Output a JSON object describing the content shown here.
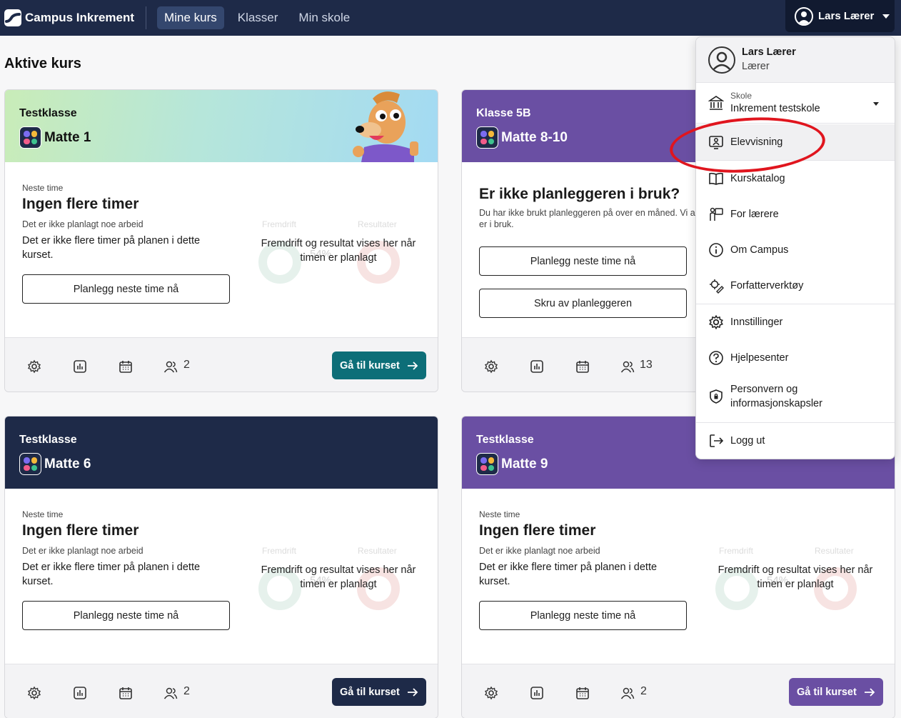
{
  "topbar": {
    "brand": "Campus Inkrement",
    "nav": [
      "Mine kurs",
      "Klasser",
      "Min skole"
    ],
    "active_nav": "Mine kurs",
    "user_name": "Lars Lærer",
    "bg_color": "#1e2a48"
  },
  "page_title": "Aktive kurs",
  "cards": [
    {
      "class_name": "Testklasse",
      "course_name": "Matte 1",
      "header_style": "gradient-mint-blue",
      "neste_label": "Neste time",
      "title": "Ingen flere timer",
      "no_work": "Det er ikke planlagt noe arbeid",
      "text": "Det er ikke flere timer på planen i dette kurset.",
      "plan_button": "Planlegg neste time nå",
      "progress_label": "Fremdrift",
      "result_label": "Resultater",
      "progress_pct": "54%",
      "overlay": "Fremdrift og resultat vises her når timen er planlagt",
      "student_count": "2",
      "go_button": "Gå til kurset",
      "go_color": "#0d6e78"
    },
    {
      "class_name": "Klasse 5B",
      "course_name": "Matte 8-10",
      "header_style": "purple",
      "planner_title": "Er ikke planleggeren i bruk?",
      "planner_text_line1": "Du har ikke brukt planleggeren på over en måned. Vi a",
      "planner_text_line2": "er i bruk.",
      "plan_button": "Planlegg neste time nå",
      "disable_button": "Skru av planleggeren",
      "student_count": "13"
    },
    {
      "class_name": "Testklasse",
      "course_name": "Matte 6",
      "header_style": "navy",
      "neste_label": "Neste time",
      "title": "Ingen flere timer",
      "no_work": "Det er ikke planlagt noe arbeid",
      "text": "Det er ikke flere timer på planen i dette kurset.",
      "plan_button": "Planlegg neste time nå",
      "progress_label": "Fremdrift",
      "result_label": "Resultater",
      "progress_pct": "54%",
      "overlay": "Fremdrift og resultat vises her når timen er planlagt",
      "student_count": "2",
      "go_button": "Gå til kurset",
      "go_color": "#1e2a48"
    },
    {
      "class_name": "Testklasse",
      "course_name": "Matte 9",
      "header_style": "purple",
      "neste_label": "Neste time",
      "title": "Ingen flere timer",
      "no_work": "Det er ikke planlagt noe arbeid",
      "text": "Det er ikke flere timer på planen i dette kurset.",
      "plan_button": "Planlegg neste time nå",
      "progress_label": "Fremdrift",
      "result_label": "Resultater",
      "progress_pct": "54%",
      "overlay": "Fremdrift og resultat vises her når timen er planlagt",
      "student_count": "2",
      "go_button": "Gå til kurset",
      "go_color": "#6a4fa3"
    }
  ],
  "menu": {
    "name": "Lars Lærer",
    "role": "Lærer",
    "school_label": "Skole",
    "school_value": "Inkrement testskole",
    "items": [
      {
        "label": "Elevvisning",
        "icon": "student-view-icon"
      },
      {
        "label": "Kurskatalog",
        "icon": "book-icon"
      },
      {
        "label": "For lærere",
        "icon": "teacher-icon"
      },
      {
        "label": "Om Campus",
        "icon": "info-icon"
      },
      {
        "label": "Forfatterverktøy",
        "icon": "author-tools-icon"
      },
      {
        "label": "Innstillinger",
        "icon": "gear-icon"
      },
      {
        "label": "Hjelpesenter",
        "icon": "help-icon"
      },
      {
        "label": "Personvern og informasjonskapsler",
        "icon": "privacy-shield-icon"
      },
      {
        "label": "Logg ut",
        "icon": "logout-icon"
      }
    ]
  },
  "colors": {
    "purple": "#6a4fa3",
    "navy": "#1e2a48",
    "teal": "#0d6e78",
    "annotation_red": "#e0151e"
  }
}
